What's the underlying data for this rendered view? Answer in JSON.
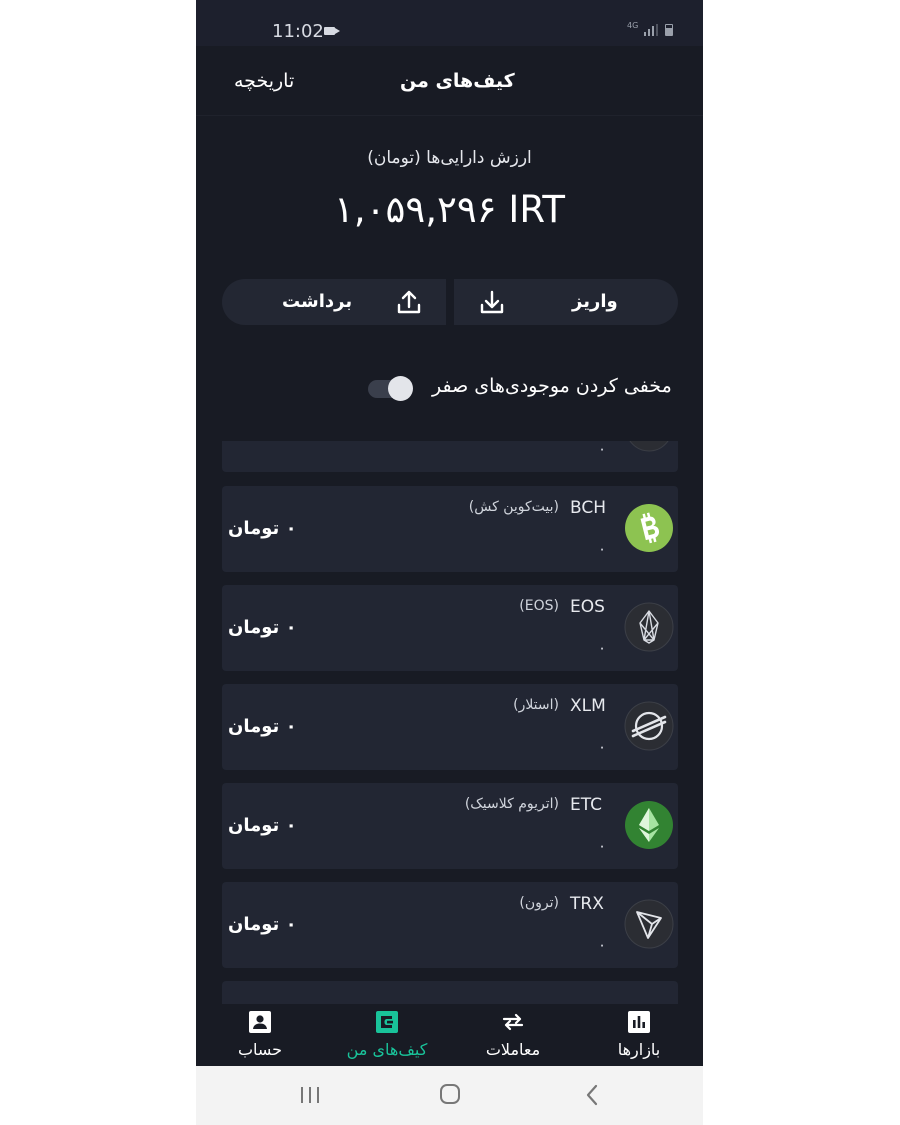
{
  "status_bar": {
    "time": "11:02",
    "network": "4G",
    "icons": [
      "video-camera-icon",
      "signal-icon",
      "battery-icon"
    ]
  },
  "top_tabs": {
    "wallet": "کیف‌های من",
    "history": "تاریخچه"
  },
  "assets": {
    "title": "ارزش دارایی‌ها (تومان)",
    "value": "۱,۰۵۹,۲۹۶ IRT"
  },
  "actions": {
    "withdraw": "برداشت",
    "deposit": "واریز"
  },
  "toggle": {
    "label": "مخفی کردن موجودی‌های صفر",
    "enabled": false
  },
  "coins": [
    {
      "symbol": "",
      "name": "",
      "amount": "۰",
      "value": "",
      "icon": "partial-coin-icon"
    },
    {
      "symbol": "BCH",
      "name": "(بیت‌کوین کش)",
      "amount": "۰",
      "value": "۰ تومان",
      "icon": "bitcoin-cash-icon",
      "color": "#8dc351"
    },
    {
      "symbol": "EOS",
      "name": "(EOS)",
      "amount": "۰",
      "value": "۰ تومان",
      "icon": "eos-icon",
      "color": "#2b2d33"
    },
    {
      "symbol": "XLM",
      "name": "(استلار)",
      "amount": "۰",
      "value": "۰ تومان",
      "icon": "stellar-icon",
      "color": "#2b2d33"
    },
    {
      "symbol": "ETC",
      "name": "(اتریوم کلاسیک)",
      "amount": "۰",
      "value": "۰ تومان",
      "icon": "ethereum-classic-icon",
      "color": "#328332"
    },
    {
      "symbol": "TRX",
      "name": "(ترون)",
      "amount": "۰",
      "value": "۰ تومان",
      "icon": "tron-icon",
      "color": "#2b2d33"
    }
  ],
  "bottom_nav": [
    {
      "label": "حساب",
      "icon": "account-icon",
      "active": false
    },
    {
      "label": "کیف‌های من",
      "icon": "wallet-icon",
      "active": true
    },
    {
      "label": "معاملات",
      "icon": "trade-arrows-icon",
      "active": false
    },
    {
      "label": "بازارها",
      "icon": "markets-chart-icon",
      "active": false
    }
  ],
  "colors": {
    "background": "#181b24",
    "card": "#222633",
    "accent": "#19c39a"
  }
}
